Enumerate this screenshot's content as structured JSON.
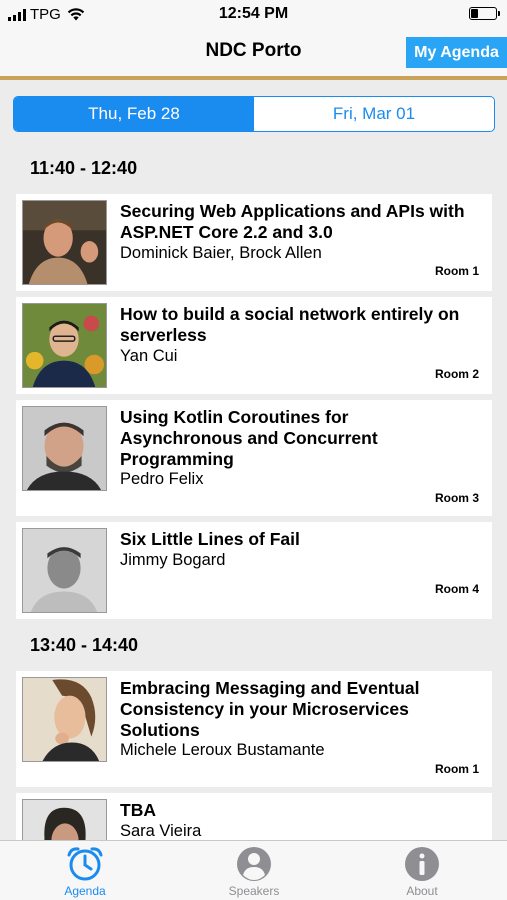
{
  "status_bar": {
    "carrier": "TPG",
    "time": "12:54 PM",
    "battery_level": 0.3
  },
  "nav": {
    "title": "NDC Porto",
    "my_agenda_label": "My Agenda"
  },
  "days": [
    {
      "label": "Thu, Feb 28",
      "selected": true
    },
    {
      "label": "Fri, Mar 01",
      "selected": false
    }
  ],
  "slots": [
    {
      "time": "11:40 - 12:40",
      "sessions": [
        {
          "title": "Securing Web Applications and APIs with ASP.NET Core 2.2 and 3.0",
          "speaker": "Dominick Baier, Brock  Allen",
          "room": "Room 1",
          "photo": "speaker-photo"
        },
        {
          "title": "How to build a social network entirely on serverless",
          "speaker": "Yan Cui",
          "room": "Room 2",
          "photo": "speaker-photo"
        },
        {
          "title": "Using Kotlin Coroutines for Asynchronous and Concurrent Programming",
          "speaker": "Pedro Felix",
          "room": "Room 3",
          "photo": "speaker-photo"
        },
        {
          "title": "Six Little Lines of Fail",
          "speaker": "Jimmy Bogard",
          "room": "Room 4",
          "photo": "speaker-photo"
        }
      ]
    },
    {
      "time": "13:40 - 14:40",
      "sessions": [
        {
          "title": "Embracing Messaging and Eventual Consistency in your Microservices Solutions",
          "speaker": "Michele Leroux Bustamante",
          "room": "Room 1",
          "photo": "speaker-photo"
        },
        {
          "title": "TBA",
          "speaker": "Sara  Vieira",
          "room": "",
          "photo": "speaker-photo"
        }
      ]
    }
  ],
  "tabs": [
    {
      "label": "Agenda",
      "icon": "alarm-clock-icon",
      "active": true
    },
    {
      "label": "Speakers",
      "icon": "person-icon",
      "active": false
    },
    {
      "label": "About",
      "icon": "info-icon",
      "active": false
    }
  ],
  "colors": {
    "accent": "#1a8cf0",
    "agenda_button": "#2aa4f4",
    "divider_gold": "#c9a35a",
    "inactive_tab": "#8e8e93"
  }
}
